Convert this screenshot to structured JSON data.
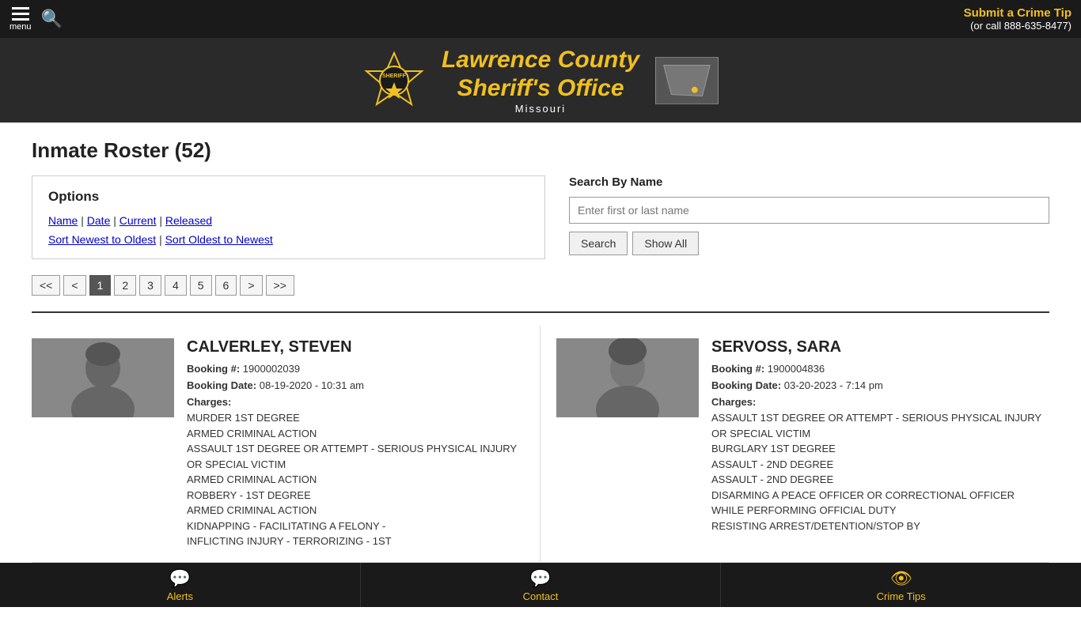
{
  "topbar": {
    "menu_label": "menu",
    "crime_tip_text": "Submit a Crime Tip",
    "crime_tip_phone": "(or call 888-635-8477)"
  },
  "header": {
    "site_name_line1": "Lawrence County",
    "site_name_line2": "Sheriff's Office",
    "site_name_line3": "Missouri"
  },
  "page": {
    "title": "Inmate Roster (52)"
  },
  "options": {
    "heading": "Options",
    "links": [
      {
        "label": "Name",
        "sep": " | "
      },
      {
        "label": "Date",
        "sep": " | "
      },
      {
        "label": "Current",
        "sep": " | "
      },
      {
        "label": "Released",
        "sep": ""
      }
    ],
    "sort_newest": "Sort Newest to Oldest",
    "sort_pipe": " | ",
    "sort_oldest": "Sort Oldest to Newest"
  },
  "search": {
    "heading": "Search By Name",
    "placeholder": "Enter first or last name",
    "search_btn": "Search",
    "show_all_btn": "Show All"
  },
  "pagination": {
    "first": "<<",
    "prev": "<",
    "pages": [
      "1",
      "2",
      "3",
      "4",
      "5",
      "6"
    ],
    "active_page": "1",
    "next": ">",
    "last": ">>"
  },
  "inmates": [
    {
      "name": "CALVERLEY, STEVEN",
      "booking_number": "1900002039",
      "booking_date": "08-19-2020 - 10:31 am",
      "charges": [
        "MURDER 1ST DEGREE",
        "ARMED CRIMINAL ACTION",
        "ASSAULT 1ST DEGREE OR ATTEMPT - SERIOUS PHYSICAL INJURY OR SPECIAL VICTIM",
        "ARMED CRIMINAL ACTION",
        "ROBBERY - 1ST DEGREE",
        "ARMED CRIMINAL ACTION",
        "KIDNAPPING - FACILITATING A FELONY -",
        "INFLICTING INJURY - TERRORIZING - 1ST"
      ]
    },
    {
      "name": "SERVOSS, SARA",
      "booking_number": "1900004836",
      "booking_date": "03-20-2023 - 7:14 pm",
      "charges": [
        "ASSAULT 1ST DEGREE OR ATTEMPT - SERIOUS PHYSICAL INJURY OR SPECIAL VICTIM",
        "BURGLARY 1ST DEGREE",
        "ASSAULT - 2ND DEGREE",
        "ASSAULT - 2ND DEGREE",
        "DISARMING A PEACE OFFICER OR CORRECTIONAL OFFICER WHILE PERFORMING OFFICIAL DUTY",
        "RESISTING ARREST/DETENTION/STOP BY"
      ]
    }
  ],
  "bottom_nav": [
    {
      "label": "Alerts",
      "icon": "💬"
    },
    {
      "label": "Contact",
      "icon": "💬"
    },
    {
      "label": "Crime Tips",
      "icon": "👁"
    }
  ]
}
